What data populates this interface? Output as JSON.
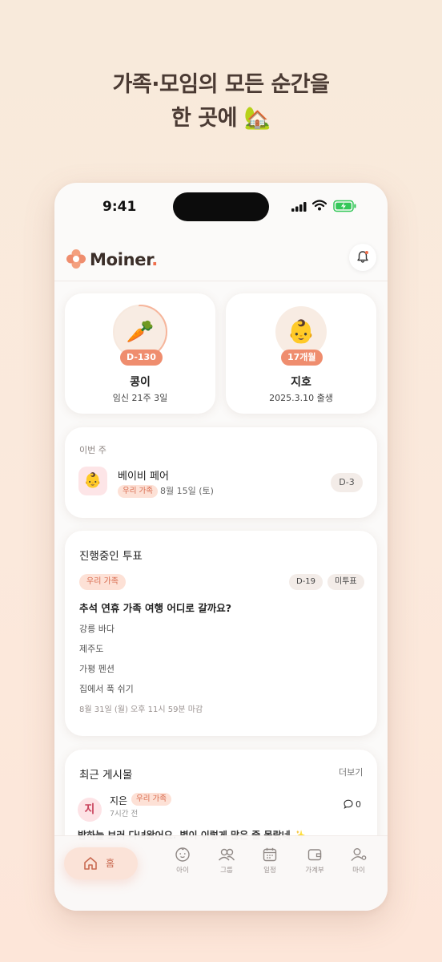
{
  "headline": {
    "line1": "가족·모임의 모든 순간을",
    "line2": "한 곳에 🏡"
  },
  "status_bar": {
    "time": "9:41"
  },
  "app": {
    "name": "Moiner",
    "name_dot": ".",
    "accent_color": "#ef6f4d"
  },
  "profiles": [
    {
      "emoji": "🥕",
      "badge": "D-130",
      "name": "콩이",
      "subtitle": "임신 21주 3일",
      "progress": 0.42
    },
    {
      "emoji": "👶",
      "badge": "17개월",
      "name": "지호",
      "subtitle": "2025.3.10 출생"
    }
  ],
  "this_week": {
    "label": "이번 주",
    "event": {
      "emoji": "👶",
      "title": "베이비 페어",
      "tag": "우리 가족",
      "date": "8월 15일 (토)",
      "dday": "D-3"
    }
  },
  "poll": {
    "section_title": "진행중인 투표",
    "tag": "우리 가족",
    "dday": "D-19",
    "status": "미투표",
    "question": "추석 연휴 가족 여행 어디로 갈까요?",
    "options": [
      "강릉 바다",
      "제주도",
      "가평 펜션",
      "집에서 푹 쉬기"
    ],
    "deadline": "8월 31일 (월) 오후 11시 59분 마감"
  },
  "recent_posts": {
    "section_title": "최근 게시물",
    "more_label": "더보기",
    "post": {
      "avatar": "지",
      "author": "지은",
      "tag": "우리 가족",
      "time": "7시간 전",
      "comments": "0",
      "body": "밤하늘 보러 다녀왔어요. 별이 이렇게 많은 줄 몰랐네 ✨"
    }
  },
  "tab_bar": {
    "home": "홈",
    "tabs": [
      {
        "icon": "baby-face-icon",
        "label": "아이"
      },
      {
        "icon": "group-icon",
        "label": "그룹"
      },
      {
        "icon": "calendar-icon",
        "label": "일정"
      },
      {
        "icon": "wallet-icon",
        "label": "가계부"
      },
      {
        "icon": "user-settings-icon",
        "label": "마이"
      }
    ]
  }
}
